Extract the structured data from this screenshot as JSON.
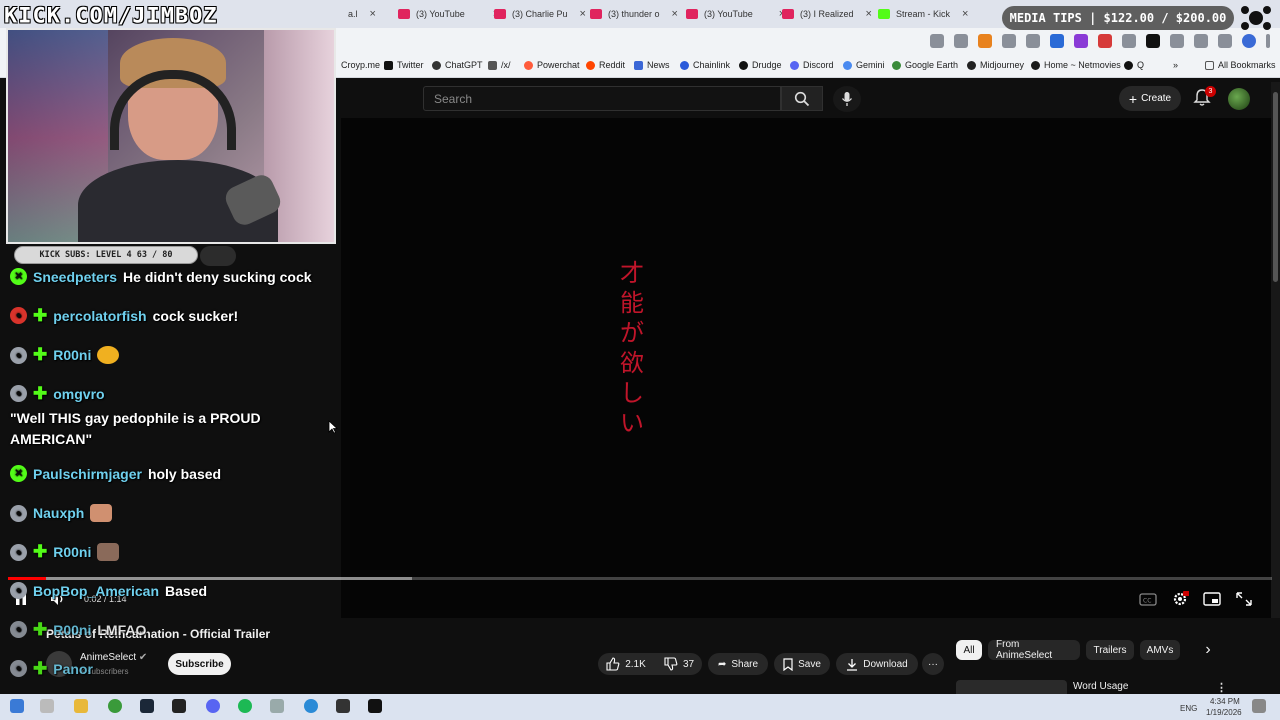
{
  "browser": {
    "tabs": [
      {
        "label": "a.l"
      },
      {
        "label": "(3) YouTube"
      },
      {
        "label": "(3) Charlie Pu"
      },
      {
        "label": "(3) thunder o"
      },
      {
        "label": "(3) YouTube"
      },
      {
        "label": "(3) I Realized"
      },
      {
        "label": "Stream - Kick"
      }
    ],
    "bookmarks": [
      "Croyp.me",
      "Twitter",
      "ChatGPT",
      "/x/",
      "Powerchat",
      "Reddit",
      "News",
      "Chainlink",
      "Drudge",
      "Discord",
      "Gemini",
      "Google Earth",
      "Midjourney",
      "Home ~ Netmovies",
      "Q"
    ],
    "all_bookmarks": "All Bookmarks",
    "more_bookmarks": "»"
  },
  "youtube": {
    "search_placeholder": "Search",
    "create_label": "Create",
    "notification_count": "3",
    "video": {
      "overlay_text": "才能が欲しい",
      "time": "0:02 / 1:14",
      "played_fraction": 0.03,
      "buffered_fraction": 0.32
    },
    "title": "Petals of Reincarnation - Official Trailer",
    "channel": {
      "name": "AnimeSelect",
      "subs": "K subscribers"
    },
    "subscribe_label": "Subscribe",
    "actions": {
      "likes": "2.1K",
      "dislikes": "37",
      "share": "Share",
      "save": "Save",
      "download": "Download",
      "more": "···"
    },
    "chips": [
      "All",
      "From AnimeSelect",
      "Trailers",
      "AMVs"
    ],
    "next_chip": "›",
    "recommendation": {
      "title": "Word Usage"
    }
  },
  "overlay": {
    "site_logo": "KICK.COM/JIMBOZ",
    "sub_goal": "KICK SUBS: LEVEL 4 63 / 80",
    "media_tips": "MEDIA TIPS | $122.00 / $200.00"
  },
  "chat": [
    {
      "user": "Sneedpeters",
      "text": "He didn't deny sucking cock",
      "badges": [
        "green"
      ]
    },
    {
      "user": "percolatorfish",
      "text": "cock sucker!",
      "badges": [
        "red",
        "plus"
      ]
    },
    {
      "user": "R00ni",
      "text": "",
      "badges": [
        "gray",
        "plus"
      ],
      "emote": "#f0b020"
    },
    {
      "user": "omgvro",
      "text": "\"Well THIS gay pedophile is a PROUD AMERICAN\"",
      "badges": [
        "gray",
        "plus"
      ]
    },
    {
      "user": "Paulschirmjager",
      "text": "holy based",
      "badges": [
        "green"
      ]
    },
    {
      "user": "Nauxph",
      "text": "",
      "badges": [
        "gray"
      ],
      "emote": "#d09070"
    },
    {
      "user": "R00ni",
      "text": "",
      "badges": [
        "gray",
        "plus"
      ],
      "emote": "#8a6a5a"
    },
    {
      "user": "BopBop_American",
      "text": "Based",
      "badges": [
        "gray"
      ]
    },
    {
      "user": "R00ni",
      "text": "LMFAO",
      "badges": [
        "gray",
        "plus"
      ]
    },
    {
      "user": "Panor",
      "text": "",
      "badges": [
        "gray",
        "plus"
      ]
    }
  ],
  "taskbar": {
    "lang": "ENG",
    "time": "4:34 PM",
    "date": "1/19/2026"
  },
  "colors": {
    "kick_green": "#53fc18",
    "chat_user": "#6fd0ee",
    "yt_red": "#ff0000",
    "jp_text": "#c0152a"
  }
}
